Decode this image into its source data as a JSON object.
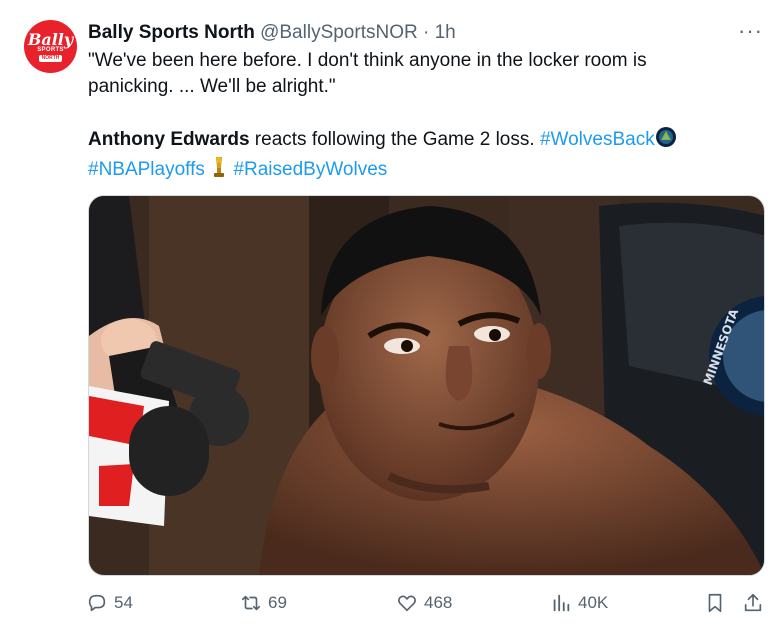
{
  "tweet": {
    "author_name": "Bally Sports North",
    "handle": "@BallySportsNOR",
    "separator": "·",
    "time": "1h",
    "more_label": "···",
    "avatar": {
      "brand": "Bally",
      "sub": "SPORTS",
      "sub2": "NORTH"
    },
    "quote_line": "\"We've been here before. I don't think anyone in the locker room is panicking. ... We'll be alright.\"",
    "mention": "Anthony Edwards",
    "body_rest": " reacts following the Game 2 loss. ",
    "hashtags": [
      "#WolvesBack",
      "#NBAPlayoffs",
      "#RaisedByWolves"
    ],
    "jersey_text": "MINNESOTA"
  },
  "metrics": {
    "replies": "54",
    "reposts": "69",
    "likes": "468",
    "views": "40K"
  },
  "colors": {
    "accent": "#1d9bf0",
    "muted": "#536471",
    "brand_red": "#e8212b"
  }
}
